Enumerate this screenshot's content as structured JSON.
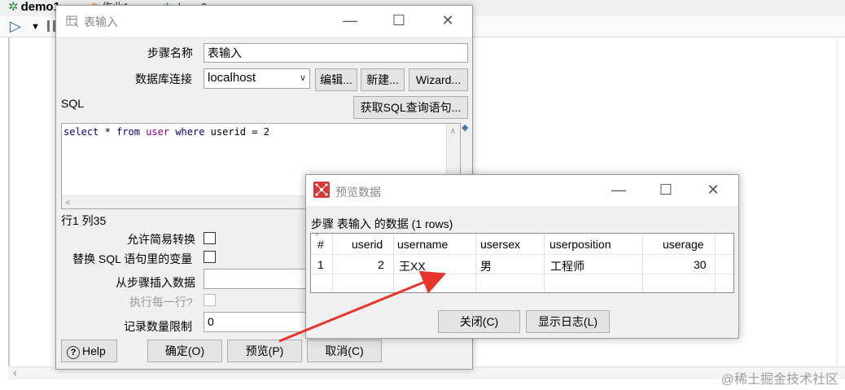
{
  "background": {
    "tab_active": "demo1",
    "tab_2": "作业1",
    "tab_3": "demo2",
    "watermark": "@稀土掘金技术社区"
  },
  "table_input_dialog": {
    "title": "表输入",
    "step_name_label": "步骤名称",
    "step_name_value": "表输入",
    "db_connection_label": "数据库连接",
    "db_connection_value": "localhost",
    "edit_button": "编辑...",
    "new_button": "新建...",
    "wizard_button": "Wizard...",
    "sql_label": "SQL",
    "get_sql_button": "获取SQL查询语句...",
    "sql": {
      "kw_select": "select",
      "star": " * ",
      "kw_from": "from",
      "table": "user",
      "kw_where": "where",
      "rest": " userid = 2"
    },
    "cursor_pos": "行1 列35",
    "allow_lazy_label": "允许简易转换",
    "replace_vars_label": "替换 SQL 语句里的变量",
    "insert_from_step_label": "从步骤插入数据",
    "execute_each_row_label": "执行每一行?",
    "limit_label": "记录数量限制",
    "limit_value": "0",
    "help_button": "Help",
    "ok_button": "确定(O)",
    "preview_button": "预览(P)",
    "cancel_button": "取消(C)"
  },
  "preview_dialog": {
    "title": "预览数据",
    "subtitle": "步骤 表输入 的数据  (1 rows)",
    "columns": [
      "#",
      "userid",
      "username",
      "usersex",
      "userposition",
      "userage"
    ],
    "rows": [
      [
        "1",
        "2",
        "王XX",
        "男",
        "工程师",
        "30"
      ]
    ],
    "close_button": "关闭(C)",
    "show_log_button": "显示日志(L)"
  },
  "colors": {
    "arrow": "#e8352b",
    "sql_keyword": "#000080",
    "sql_table": "#8b008b"
  }
}
